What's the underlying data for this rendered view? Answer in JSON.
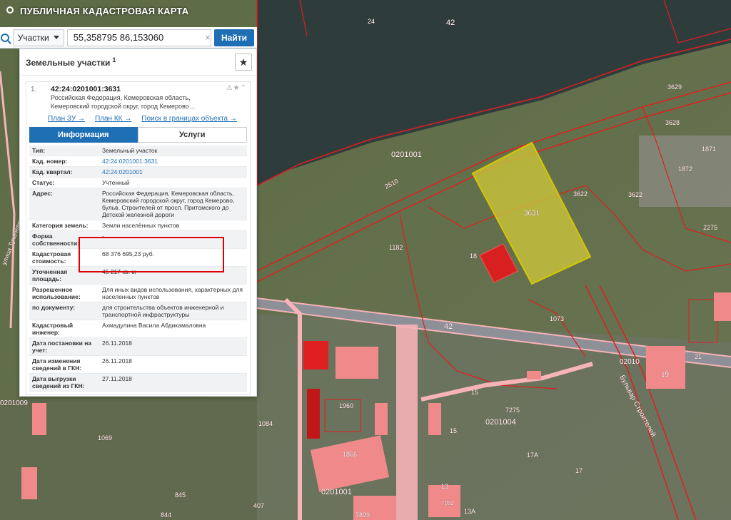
{
  "app": {
    "title": "ПУБЛИЧНАЯ КАДАСТРОВАЯ КАРТА"
  },
  "search": {
    "type_label": "Участки",
    "value": "55,358795 86,153060",
    "button_label": "Найти",
    "clear_glyph": "×"
  },
  "panel": {
    "title": "Земельные участки",
    "count": "1",
    "star_glyph": "★"
  },
  "card": {
    "index": "1.",
    "cad_number": "42:24:0201001:3631",
    "address_short_1": "Российская Федерация, Кемеровская область,",
    "address_short_2": "Кемеровский городской округ, город Кемерово…",
    "status_icons": "⚠★⌃",
    "links": {
      "plan_zu": "План ЗУ →",
      "plan_kk": "План КК →",
      "search": "Поиск в границах объекта →"
    },
    "tabs": {
      "info": "Информация",
      "services": "Услуги"
    }
  },
  "attributes": [
    {
      "key": "Тип:",
      "value": "Земельный участок"
    },
    {
      "key": "Кад. номер:",
      "value": "42:24:0201001:3631",
      "link": true
    },
    {
      "key": "Кад. квартал:",
      "value": "42:24:0201001",
      "link": true
    },
    {
      "key": "Статус:",
      "value": "Учтенный"
    },
    {
      "key": "Адрес:",
      "value": "Российская Федерация, Кемеровская область, Кемеровский городской округ, город Кемерово, бульв. Строителей от просп. Притомского до Детской железной дороги"
    },
    {
      "key": "Категория земель:",
      "value": "Земли населённых пунктов"
    },
    {
      "key": "Форма собственности:",
      "value": "-"
    },
    {
      "key": "Кадастровая стоимость:",
      "value": "68 376 695,23 руб."
    },
    {
      "key": "Уточненная площадь:",
      "value": "45 217 кв. м"
    },
    {
      "key": "Разрешенное использование:",
      "value": "Для иных видов использования, характерных для населенных пунктов"
    },
    {
      "key": "по документу:",
      "value": "для строительства объектов инженерной и транспортной инфраструктуры"
    },
    {
      "key": "Кадастровый инженер:",
      "value": "Ахмадулина Васила Абдикамаловна"
    },
    {
      "key": "Дата постановки на учет:",
      "value": "26.11.2018"
    },
    {
      "key": "Дата изменения сведений в ГКН:",
      "value": "26.11.2018"
    },
    {
      "key": "Дата выгрузки сведений из ГКН:",
      "value": "27.11.2018"
    }
  ],
  "map": {
    "labels": {
      "quarter_main": "0201001",
      "quarter_lower": "0201001",
      "quarter_east": "0201004",
      "quarter_right": "02010",
      "road_42_top": "42",
      "road_42_mid": "42",
      "road_24": "24",
      "plot_3631": "3631",
      "plot_3622": "3622",
      "plot_3622b": "3622",
      "plot_3628": "3628",
      "plot_1871": "1871",
      "plot_1872": "1872",
      "plot_2275": "2275",
      "plot_2510": "2510",
      "plot_1182": "1182",
      "plot_18": "18",
      "plot_7275": "7275",
      "plot_15": "15",
      "plot_15b": "15",
      "plot_17": "17",
      "plot_17a": "17А",
      "plot_19": "19",
      "plot_21": "21",
      "plot_13": "13",
      "plot_13a": "13А",
      "plot_3629": "3629",
      "plot_7899": "7899",
      "plot_7052": "7052",
      "plot_1069": "1069",
      "plot_845": "845",
      "plot_844": "844",
      "plot_407": "407",
      "plot_1084": "1084",
      "plot_1866": "1866",
      "plot_1960": "1960",
      "plot_1073": "1073",
      "street_boulevard": "Бульвар Строителей",
      "street_left": "улица Тухачевского",
      "quarter_left": "0201009"
    },
    "colors": {
      "selected_fill": "#c8c23a",
      "selected_stroke": "#d6c800",
      "boundary": "#e01e1e",
      "building_fill": "#f08a8a",
      "road_fill": "#f6b3b8"
    }
  }
}
